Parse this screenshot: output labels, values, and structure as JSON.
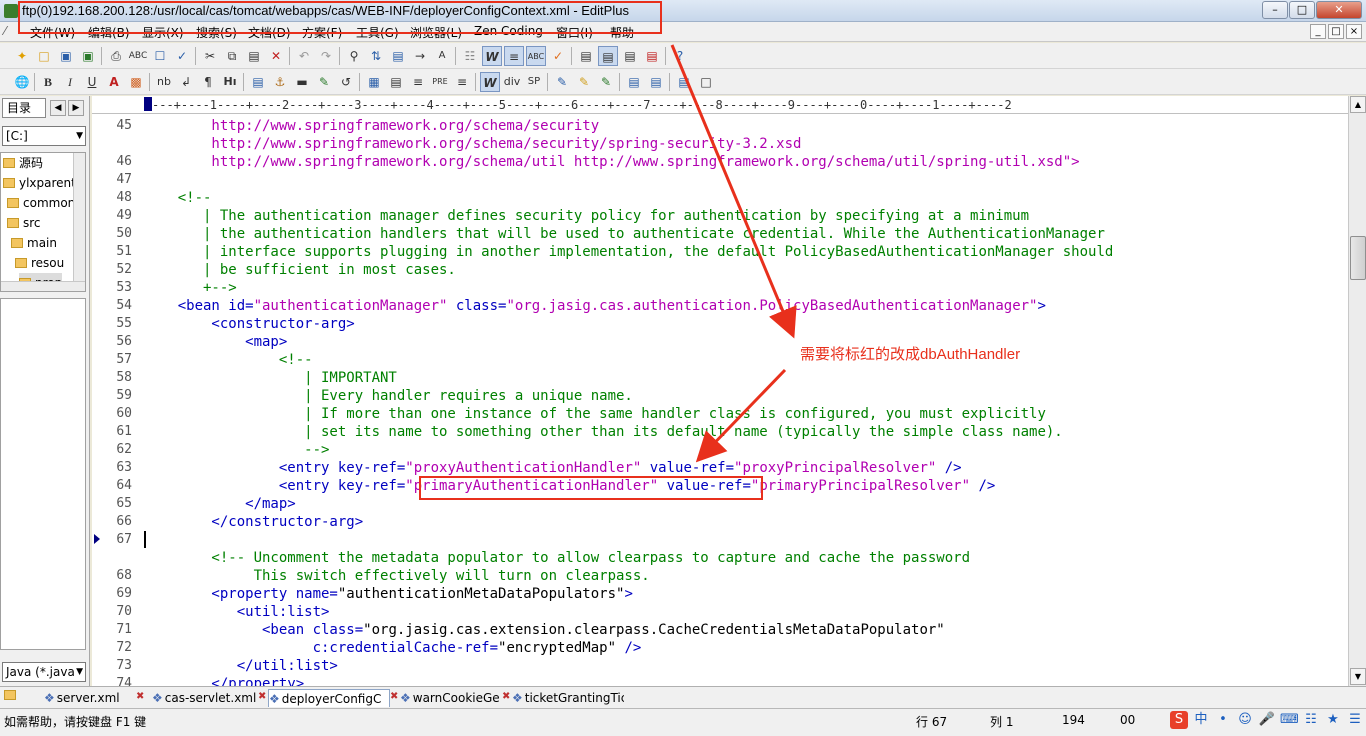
{
  "window": {
    "title": "ftp(0)192.168.200.128:/usr/local/cas/tomcat/webapps/cas/WEB-INF/deployerConfigContext.xml - EditPlus"
  },
  "menu": [
    "文件(W)",
    "编辑(B)",
    "显示(X)",
    "搜索(S)",
    "文档(D)",
    "方案(F)",
    "工具(G)",
    "浏览器(L)",
    "Zen Coding",
    "窗口(I)",
    "帮助"
  ],
  "left_panel": {
    "tab_label": "目录",
    "drive": "[C:]",
    "tree": [
      "源码",
      "ylxparent",
      "common",
      "src",
      "main",
      "resou",
      "prop"
    ],
    "filter": "Java (*.java"
  },
  "ruler": "---+----1----+----2----+----3----+----4----+----5----+----6----+----7----+----8----+----9----+----0----+----1----+----2",
  "editor": {
    "lines": [
      {
        "n": "45",
        "parts": [
          {
            "t": "        http://www.springframework.org/schema/security",
            "c": "url"
          }
        ]
      },
      {
        "n": "",
        "parts": [
          {
            "t": "        http://www.springframework.org/schema/security/spring-security-3.2.xsd",
            "c": "url"
          }
        ]
      },
      {
        "n": "46",
        "parts": [
          {
            "t": "        http://www.springframework.org/schema/util http://www.springframework.org/schema/util/spring-util.xsd\">",
            "c": "url"
          }
        ]
      },
      {
        "n": "47",
        "parts": [
          {
            "t": "",
            "c": "text"
          }
        ]
      },
      {
        "n": "48",
        "parts": [
          {
            "t": "    <!--",
            "c": "comment"
          }
        ]
      },
      {
        "n": "49",
        "parts": [
          {
            "t": "       | The authentication manager defines security policy for authentication by specifying at a minimum",
            "c": "comment"
          }
        ]
      },
      {
        "n": "50",
        "parts": [
          {
            "t": "       | the authentication handlers that will be used to authenticate credential. While the AuthenticationManager",
            "c": "comment"
          }
        ]
      },
      {
        "n": "51",
        "parts": [
          {
            "t": "       | interface supports plugging in another implementation, the default PolicyBasedAuthenticationManager should",
            "c": "comment"
          }
        ]
      },
      {
        "n": "52",
        "parts": [
          {
            "t": "       | be sufficient in most cases.",
            "c": "comment"
          }
        ]
      },
      {
        "n": "53",
        "parts": [
          {
            "t": "       +-->",
            "c": "comment"
          }
        ]
      },
      {
        "n": "54",
        "parts": [
          {
            "t": "    <bean id=",
            "c": "tag"
          },
          {
            "t": "\"authenticationManager\"",
            "c": "str"
          },
          {
            "t": " class=",
            "c": "tag"
          },
          {
            "t": "\"org.jasig.cas.authentication.PolicyBasedAuthenticationManager\"",
            "c": "str"
          },
          {
            "t": ">",
            "c": "tag"
          }
        ]
      },
      {
        "n": "55",
        "parts": [
          {
            "t": "        <constructor-arg>",
            "c": "tag"
          }
        ]
      },
      {
        "n": "56",
        "parts": [
          {
            "t": "            <map>",
            "c": "tag"
          }
        ]
      },
      {
        "n": "57",
        "parts": [
          {
            "t": "                <!--",
            "c": "comment"
          }
        ]
      },
      {
        "n": "58",
        "parts": [
          {
            "t": "                   | IMPORTANT",
            "c": "comment"
          }
        ]
      },
      {
        "n": "59",
        "parts": [
          {
            "t": "                   | Every handler requires a unique name.",
            "c": "comment"
          }
        ]
      },
      {
        "n": "60",
        "parts": [
          {
            "t": "                   | If more than one instance of the same handler class is configured, you must explicitly",
            "c": "comment"
          }
        ]
      },
      {
        "n": "61",
        "parts": [
          {
            "t": "                   | set its name to something other than its default name (typically the simple class name).",
            "c": "comment"
          }
        ]
      },
      {
        "n": "62",
        "parts": [
          {
            "t": "                   -->",
            "c": "comment"
          }
        ]
      },
      {
        "n": "63",
        "parts": [
          {
            "t": "                <entry key-ref=",
            "c": "tag"
          },
          {
            "t": "\"proxyAuthenticationHandler\"",
            "c": "str"
          },
          {
            "t": " value-ref=",
            "c": "tag"
          },
          {
            "t": "\"proxyPrincipalResolver\"",
            "c": "str"
          },
          {
            "t": " />",
            "c": "tag"
          }
        ]
      },
      {
        "n": "64",
        "parts": [
          {
            "t": "                <entry key-ref=",
            "c": "tag"
          },
          {
            "t": "\"primaryAuthenticationHandler\"",
            "c": "str"
          },
          {
            "t": " value-ref=",
            "c": "tag"
          },
          {
            "t": "\"primaryPrincipalResolver\"",
            "c": "str"
          },
          {
            "t": " />",
            "c": "tag"
          }
        ]
      },
      {
        "n": "65",
        "parts": [
          {
            "t": "            </map>",
            "c": "tag"
          }
        ]
      },
      {
        "n": "66",
        "parts": [
          {
            "t": "        </constructor-arg>",
            "c": "tag"
          }
        ]
      },
      {
        "n": "67",
        "parts": [
          {
            "t": "",
            "c": "text"
          }
        ]
      },
      {
        "n": "",
        "parts": [
          {
            "t": "        <!-- Uncomment the metadata populator to allow clearpass to capture and cache the password",
            "c": "comment"
          }
        ]
      },
      {
        "n": "68",
        "parts": [
          {
            "t": "             This switch effectively will turn on clearpass.",
            "c": "comment"
          }
        ]
      },
      {
        "n": "69",
        "parts": [
          {
            "t": "        <property name=",
            "c": "tag"
          },
          {
            "t": "\"authenticationMetaDataPopulators\"",
            "c": "text"
          },
          {
            "t": ">",
            "c": "tag"
          }
        ]
      },
      {
        "n": "70",
        "parts": [
          {
            "t": "           <util:list>",
            "c": "tag"
          }
        ]
      },
      {
        "n": "71",
        "parts": [
          {
            "t": "              <bean class=",
            "c": "tag"
          },
          {
            "t": "\"org.jasig.cas.extension.clearpass.CacheCredentialsMetaDataPopulator\"",
            "c": "text"
          }
        ]
      },
      {
        "n": "72",
        "parts": [
          {
            "t": "                    c:credentialCache-ref=",
            "c": "tag"
          },
          {
            "t": "\"encryptedMap\"",
            "c": "text"
          },
          {
            "t": " />",
            "c": "tag"
          }
        ]
      },
      {
        "n": "73",
        "parts": [
          {
            "t": "           </util:list>",
            "c": "tag"
          }
        ]
      },
      {
        "n": "74",
        "parts": [
          {
            "t": "        </property>",
            "c": "tag"
          }
        ]
      }
    ]
  },
  "annotation": {
    "note": "需要将标红的改成dbAuthHandler",
    "color": "#e8301c"
  },
  "tabs": [
    "server.xml",
    "cas-servlet.xml",
    "deployerConfigC",
    "warnCookieGene",
    "ticketGrantingTic"
  ],
  "status": {
    "help": "如需帮助，请按键盘 F1 键",
    "line": "行 67",
    "col": "列 1",
    "count": "194",
    "misc": "00"
  },
  "ime": {
    "mode": "中"
  }
}
